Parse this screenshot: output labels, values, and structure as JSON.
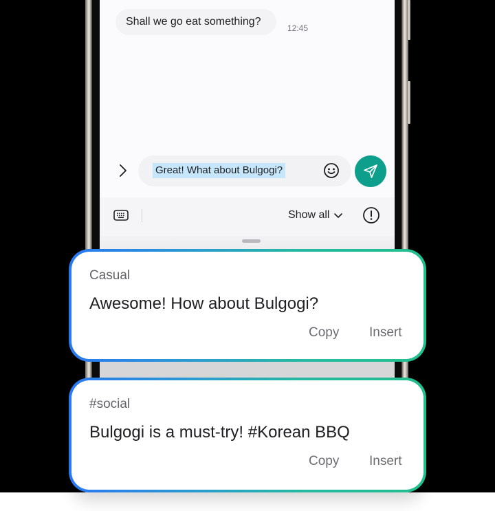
{
  "chat": {
    "received_message": "Shall we go eat something?",
    "timestamp": "12:45"
  },
  "composer": {
    "input_value": "Great! What about Bulgogi?",
    "expand_icon": "chevron-right-icon",
    "emoji_icon": "smiley-icon",
    "send_icon": "paper-plane-icon",
    "send_color": "#0e9e8c"
  },
  "toolbar": {
    "keyboard_icon": "keyboard-icon",
    "show_all_label": "Show all",
    "show_all_icon": "chevron-down-icon",
    "info_icon": "exclamation-circle-icon"
  },
  "suggestions": [
    {
      "label": "Casual",
      "text": "Awesome! How about Bulgogi?",
      "copy_label": "Copy",
      "insert_label": "Insert"
    },
    {
      "label": "#social",
      "text": "Bulgogi is a must-try! #Korean BBQ",
      "copy_label": "Copy",
      "insert_label": "Insert"
    }
  ],
  "colors": {
    "card_border_start": "#2a78f2",
    "card_border_end": "#22bf8e",
    "selection_highlight": "#c6e7fb"
  }
}
